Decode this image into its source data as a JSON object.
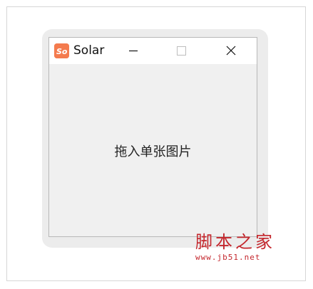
{
  "window": {
    "title": "Solar",
    "icon": "solar-app-icon",
    "icon_letters": "So",
    "icon_color": "#f47b4e",
    "controls": [
      "minimize-icon",
      "maximize-icon",
      "close-icon"
    ]
  },
  "content": {
    "drop_hint": "拖入单张图片"
  },
  "watermark": {
    "name": "脚本之家",
    "url": "www.jb51.net",
    "color": "#c4272d"
  }
}
